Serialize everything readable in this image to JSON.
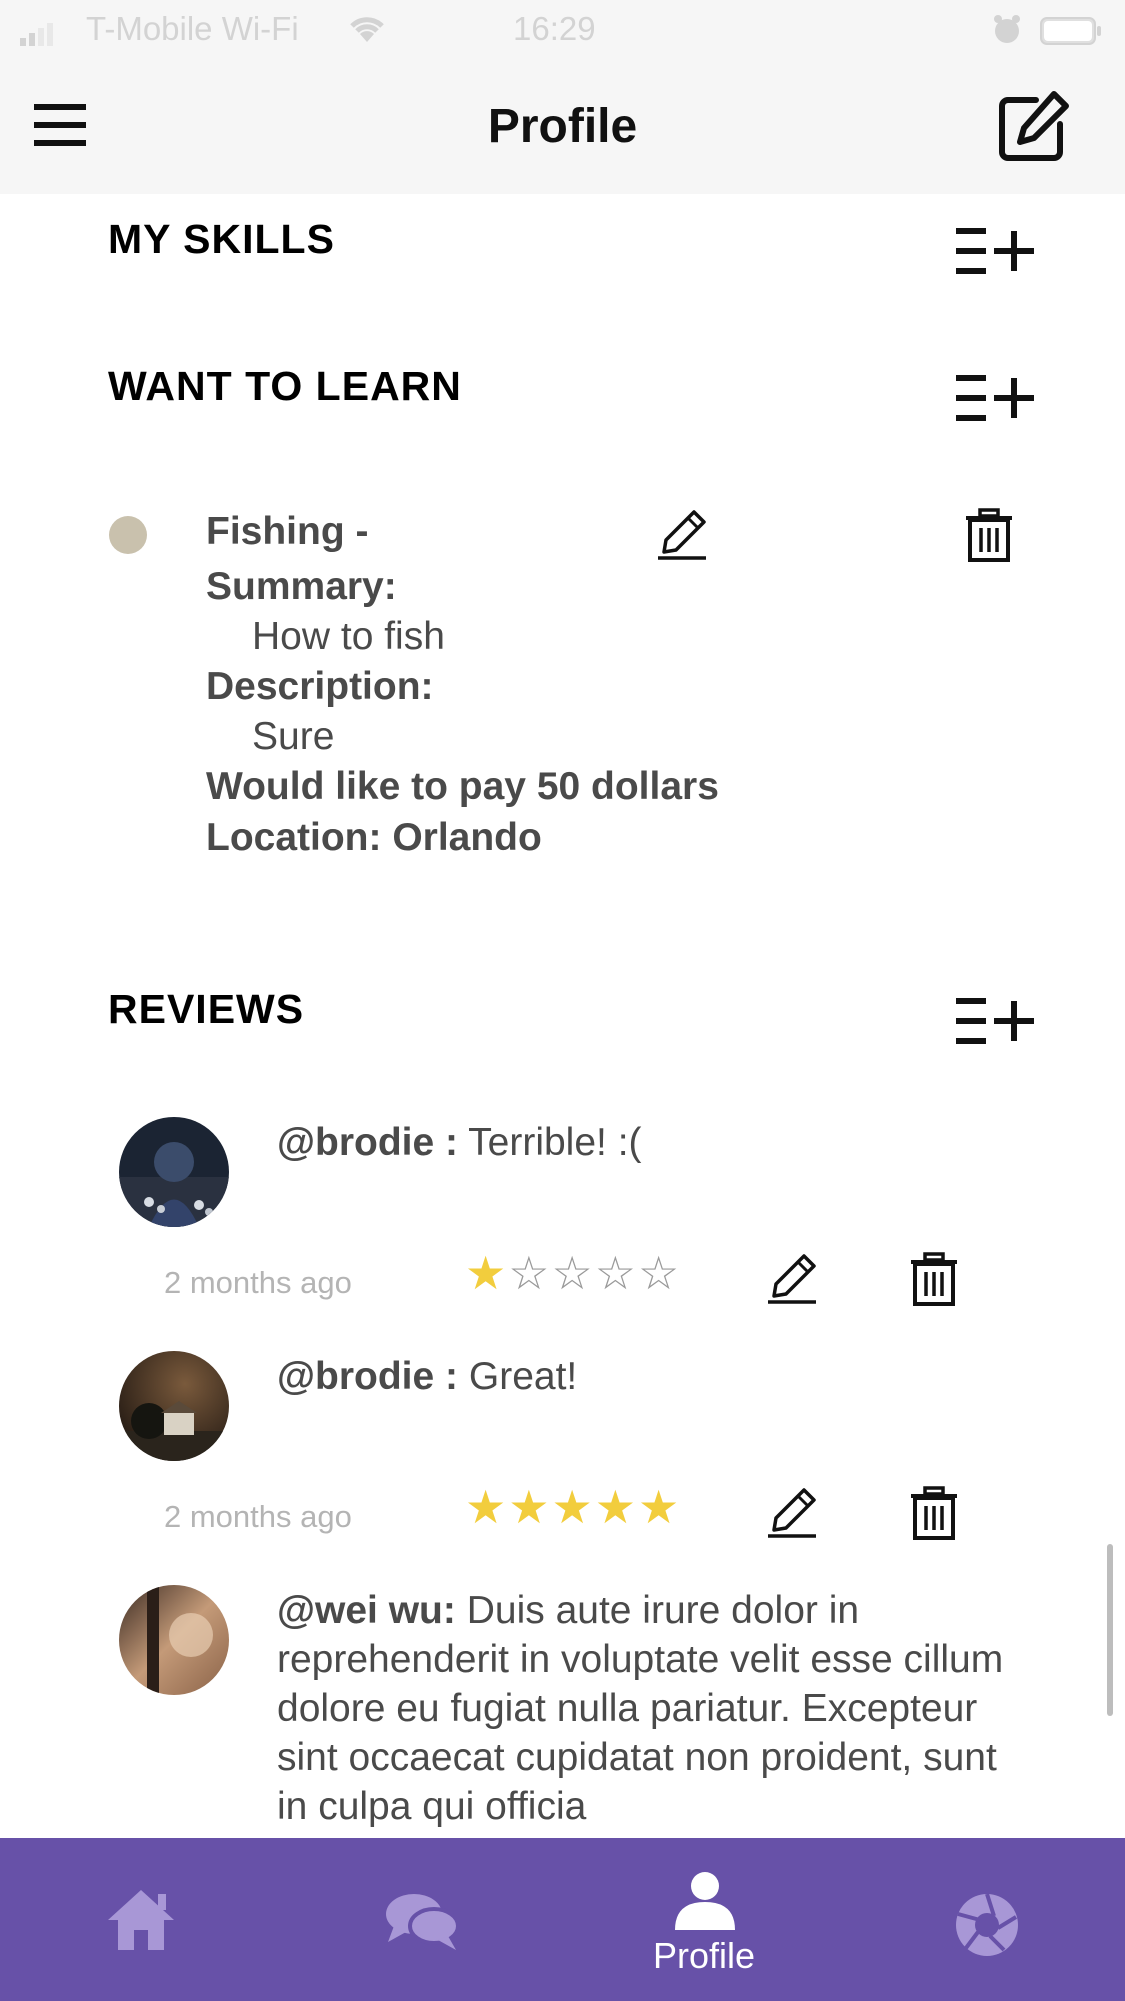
{
  "status_bar": {
    "carrier": "T-Mobile Wi-Fi",
    "time": "16:29"
  },
  "header": {
    "title": "Profile"
  },
  "sections": {
    "my_skills": "MY SKILLS",
    "want_to_learn": "WANT TO LEARN",
    "reviews": "REVIEWS"
  },
  "learn_item": {
    "title": "Fishing -",
    "summary_label": "Summary:",
    "summary": "How to fish",
    "description_label": "Description:",
    "description": "Sure",
    "pay": "Would like to pay 50 dollars",
    "location": "Location: Orlando"
  },
  "reviews": [
    {
      "user": "@brodie :",
      "text": " Terrible! :(",
      "time": "2 months ago",
      "rating": 1,
      "max_rating": 5
    },
    {
      "user": "@brodie :",
      "text": " Great!",
      "time": "2 months ago",
      "rating": 5,
      "max_rating": 5
    },
    {
      "user": "@wei wu:",
      "text": " Duis aute irure dolor in reprehenderit in voluptate velit esse cillum dolore eu fugiat nulla pariatur. Excepteur sint occaecat cupidatat non proident, sunt in culpa qui officia"
    }
  ],
  "tabbar": {
    "profile_label": "Profile"
  },
  "colors": {
    "tabbar": "#6751a8",
    "star": "#f2cd3d",
    "icon_inactive": "#a897d6"
  }
}
